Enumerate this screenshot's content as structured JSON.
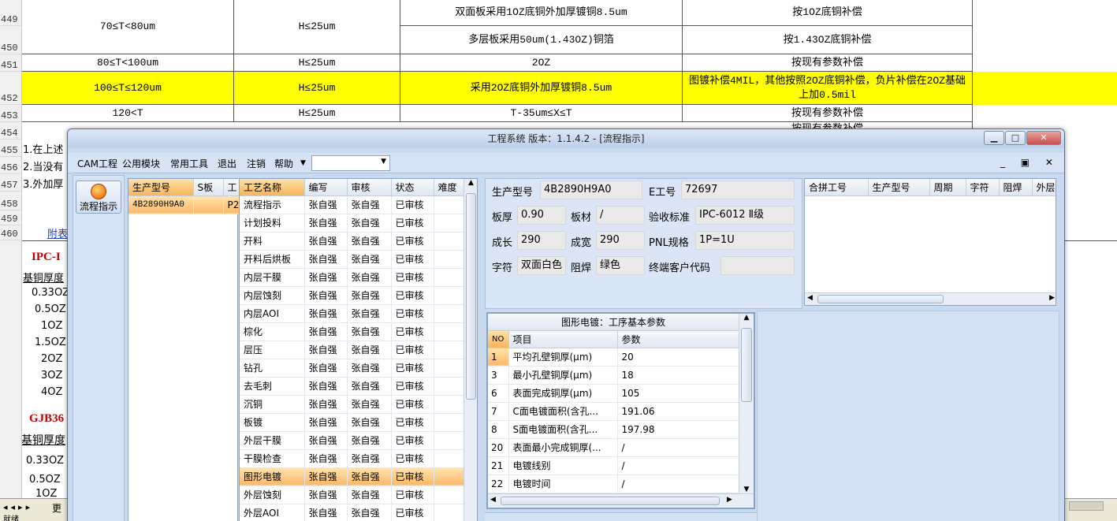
{
  "sheet": {
    "row_numbers": [
      "449",
      "450",
      "451",
      "452",
      "453",
      "454",
      "455",
      "456",
      "457",
      "458",
      "459",
      "460"
    ],
    "rows": [
      {
        "c1": "70≤T<80um",
        "c2": "H≤25um",
        "c3a": "双面板采用1OZ底铜外加厚镀铜8.5um",
        "c3b": "多层板采用50um(1.43OZ)铜箔",
        "c4a": "按1OZ底铜补偿",
        "c4b": "按1.43OZ底铜补偿"
      },
      {
        "c1": "80≤T<100um",
        "c2": "H≤25um",
        "c3": "2OZ",
        "c4": "按现有参数补偿"
      },
      {
        "c1": "100≤T≤120um",
        "c2": "H≤25um",
        "c3": "采用2OZ底铜外加厚镀铜8.5um",
        "c4": "图镀补偿4MIL，其他按照2OZ底铜补偿，负片补偿在2OZ基础上加0.5mil"
      },
      {
        "c1": "120<T",
        "c2": "H≤25um",
        "c3": "T-35um≤X≤T",
        "c4": "按现有参数补偿"
      }
    ],
    "row454_partial": "按现有参数补偿",
    "notes": [
      "1.在上述",
      "2.当没有",
      "3.外加厚"
    ],
    "appendix_link": "附表",
    "ipc_heading": "IPC-I",
    "base_copper_label": "基铜厚度",
    "thickness_list": [
      "0.33OZ",
      "0.5OZ",
      "1OZ",
      "1.5OZ",
      "2OZ",
      "3OZ",
      "4OZ"
    ],
    "gjb_heading": "GJB36",
    "base_copper_label2": "基铜厚度",
    "thickness_list2": [
      "0.33OZ",
      "0.5OZ",
      "1OZ"
    ],
    "sheet_tab": "更",
    "status": "就绪"
  },
  "window": {
    "title": "工程系统  版本：1.1.4.2 - [流程指示]",
    "menu": [
      "CAM工程",
      "公用模块",
      "常用工具",
      "退出",
      "注销",
      "帮助"
    ],
    "nav_button": "流程指示",
    "model_grid": {
      "headers": [
        "生产型号",
        "S板",
        "工"
      ],
      "rows": [
        [
          "4B2890H9A0",
          "",
          "P2"
        ]
      ]
    },
    "process_grid": {
      "headers": [
        "工艺名称",
        "编写",
        "审核",
        "状态",
        "难度"
      ],
      "rows": [
        [
          "流程指示",
          "张自强",
          "张自强",
          "已审核",
          ""
        ],
        [
          "计划投料",
          "张自强",
          "张自强",
          "已审核",
          ""
        ],
        [
          "开料",
          "张自强",
          "张自强",
          "已审核",
          ""
        ],
        [
          "开料后烘板",
          "张自强",
          "张自强",
          "已审核",
          ""
        ],
        [
          "内层干膜",
          "张自强",
          "张自强",
          "已审核",
          ""
        ],
        [
          "内层蚀刻",
          "张自强",
          "张自强",
          "已审核",
          ""
        ],
        [
          "内层AOI",
          "张自强",
          "张自强",
          "已审核",
          ""
        ],
        [
          "棕化",
          "张自强",
          "张自强",
          "已审核",
          ""
        ],
        [
          "层压",
          "张自强",
          "张自强",
          "已审核",
          ""
        ],
        [
          "钻孔",
          "张自强",
          "张自强",
          "已审核",
          ""
        ],
        [
          "去毛刺",
          "张自强",
          "张自强",
          "已审核",
          ""
        ],
        [
          "沉铜",
          "张自强",
          "张自强",
          "已审核",
          ""
        ],
        [
          "板镀",
          "张自强",
          "张自强",
          "已审核",
          ""
        ],
        [
          "外层干膜",
          "张自强",
          "张自强",
          "已审核",
          ""
        ],
        [
          "干膜检查",
          "张自强",
          "张自强",
          "已审核",
          ""
        ],
        [
          "图形电镀",
          "张自强",
          "张自强",
          "已审核",
          ""
        ],
        [
          "外层蚀刻",
          "张自强",
          "张自强",
          "已审核",
          ""
        ],
        [
          "外层AOI",
          "张自强",
          "张自强",
          "已审核",
          ""
        ]
      ],
      "selected_row": "图形电镀"
    },
    "info": {
      "model_label": "生产型号",
      "model_value": "4B2890H9A0",
      "e_no_label": "E工号",
      "e_no_value": "72697",
      "thickness_label": "板厚",
      "thickness_value": "0.90",
      "material_label": "板材",
      "material_value": "/",
      "standard_label": "验收标准",
      "standard_value": "IPC-6012 Ⅱ级",
      "length_label": "成长",
      "length_value": "290",
      "width_label": "成宽",
      "width_value": "290",
      "pnl_label": "PNL规格",
      "pnl_value": "1P=1U",
      "char_label": "字符",
      "char_value": "双面白色",
      "mask_label": "阻焊",
      "mask_value": "绿色",
      "customer_label": "终端客户代码",
      "customer_value": ""
    },
    "merge_grid": {
      "headers": [
        "合拼工号",
        "生产型号",
        "周期",
        "字符",
        "阻焊",
        "外层"
      ]
    },
    "params": {
      "title": "图形电镀：工序基本参数",
      "headers": [
        "NO",
        "项目",
        "参数"
      ],
      "rows": [
        [
          "1",
          "平均孔壁铜厚(μm)",
          "20"
        ],
        [
          "3",
          "最小孔壁铜厚(μm)",
          "18"
        ],
        [
          "6",
          "表面完成铜厚(μm)",
          "105"
        ],
        [
          "7",
          "C面电镀面积(含孔...",
          "191.06"
        ],
        [
          "8",
          "S面电镀面积(含孔...",
          "197.98"
        ],
        [
          "20",
          "表面最小完成铜厚(...",
          "/"
        ],
        [
          "21",
          "电镀线别",
          "/"
        ],
        [
          "22",
          "电镀时间",
          "/"
        ]
      ]
    }
  }
}
